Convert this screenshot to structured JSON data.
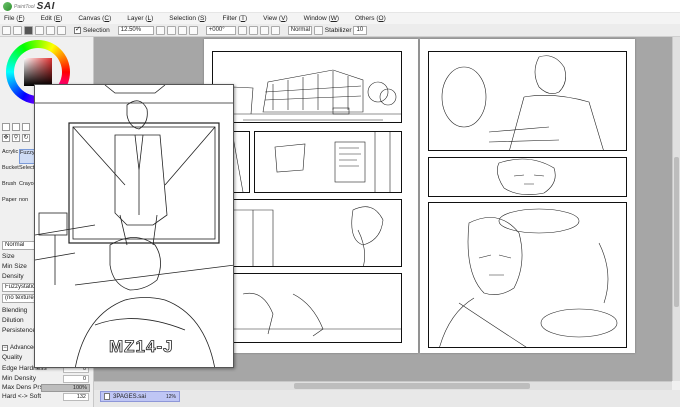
{
  "app": {
    "logo_small": "PaintTool",
    "logo_name": "SAI"
  },
  "menu": {
    "items": [
      {
        "label": "File",
        "key": "F"
      },
      {
        "label": "Edit",
        "key": "E"
      },
      {
        "label": "Canvas",
        "key": "C"
      },
      {
        "label": "Layer",
        "key": "L"
      },
      {
        "label": "Selection",
        "key": "S"
      },
      {
        "label": "Filter",
        "key": "T"
      },
      {
        "label": "View",
        "key": "V"
      },
      {
        "label": "Window",
        "key": "W"
      },
      {
        "label": "Others",
        "key": "O"
      }
    ]
  },
  "toolbar": {
    "selection_label": "Selection",
    "zoom": "12.50%",
    "rotation": "+000°",
    "blend_mode": "Normal",
    "stabilizer_label": "Stabilizer",
    "stabilizer_value": "10"
  },
  "tools": {
    "items": [
      {
        "label": "Acrylic"
      },
      {
        "label": "Fuzzy"
      },
      {
        "label": "Bucket"
      },
      {
        "label": "Select"
      },
      {
        "label": "Brush"
      },
      {
        "label": "Crayon"
      },
      {
        "label": "Paper"
      },
      {
        "label": "non"
      }
    ],
    "selected_index": 1
  },
  "properties": {
    "mode": "Normal",
    "size_label": "Size",
    "min_size_label": "Min Size",
    "density_label": "Density",
    "shape": "Fuzzystatic",
    "texture": "(no texture)",
    "blending_label": "Blending",
    "dilution_label": "Dilution",
    "persistence_label": "Persistence",
    "advanced_label": "Advanced",
    "quality_label": "Quality",
    "edge_hardness_label": "Edge Hardness",
    "edge_hardness_value": "0",
    "min_density_label": "Min Density",
    "min_density_value": "0",
    "max_dens_label": "Max Dens Prs.",
    "max_dens_value": "100%",
    "max_dens_level": 1.0,
    "hard_soft_label": "Hard <-> Soft",
    "hard_soft_value": "132"
  },
  "preview": {
    "label_text": "MZ14-J"
  },
  "filetab": {
    "name": "3PAGES.sai",
    "zoom": "12%"
  },
  "colors": {
    "accent": "#7b9bd9",
    "tab": "#bfc6f5",
    "canvas_bg": "#a6a6a6"
  },
  "icons": [
    "pointer-icon",
    "zoom-icon",
    "move-icon",
    "hand-icon",
    "rotate-icon"
  ]
}
